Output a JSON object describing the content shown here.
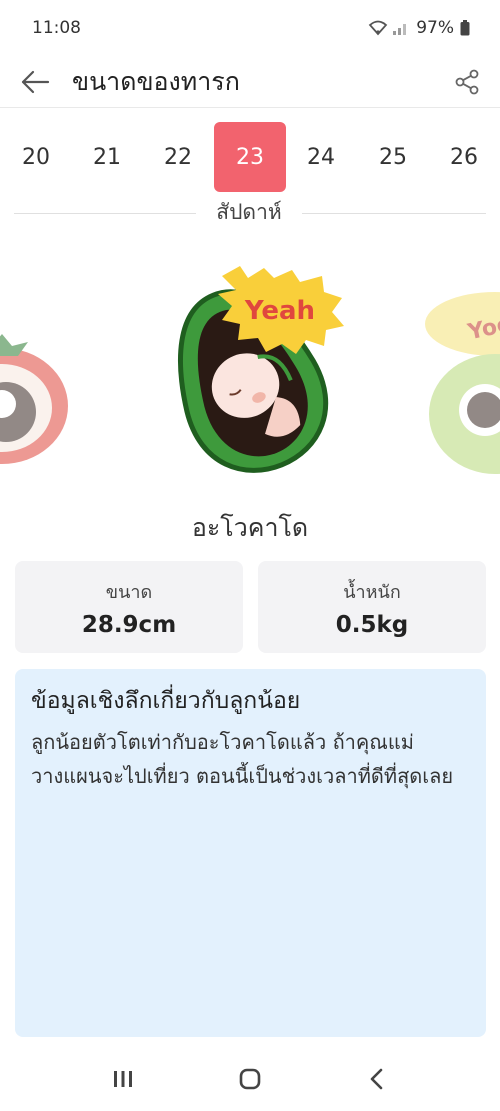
{
  "status_bar": {
    "time": "11:08",
    "battery": "97%"
  },
  "app_bar": {
    "title": "ขนาดของทารก"
  },
  "weeks": {
    "items": [
      "20",
      "21",
      "22",
      "23",
      "24",
      "25",
      "26"
    ],
    "selected_index": 3,
    "label": "สัปดาห์"
  },
  "carousel": {
    "main_bubble_text": "Yeah",
    "right_bubble_text": "Yoo-"
  },
  "fruit": {
    "name": "อะโวคาโด"
  },
  "stats": {
    "size_label": "ขนาด",
    "size_value": "28.9cm",
    "weight_label": "น้ำหนัก",
    "weight_value": "0.5kg"
  },
  "insight": {
    "title": "ข้อมูลเชิงลึกเกี่ยวกับลูกน้อย",
    "body": "ลูกน้อยตัวโตเท่ากับอะโวคาโดแล้ว ถ้าคุณแม่วางแผนจะไปเที่ยว ตอนนี้เป็นช่วงเวลาที่ดีที่สุดเลย"
  },
  "colors": {
    "accent": "#f2636e",
    "insight_bg": "#e3f1fd",
    "card_bg": "#f3f3f5"
  },
  "icons": {
    "back": "arrow-left-icon",
    "share": "share-icon",
    "nav_recents": "recents-icon",
    "nav_home": "home-icon",
    "nav_back": "chevron-left-icon"
  }
}
